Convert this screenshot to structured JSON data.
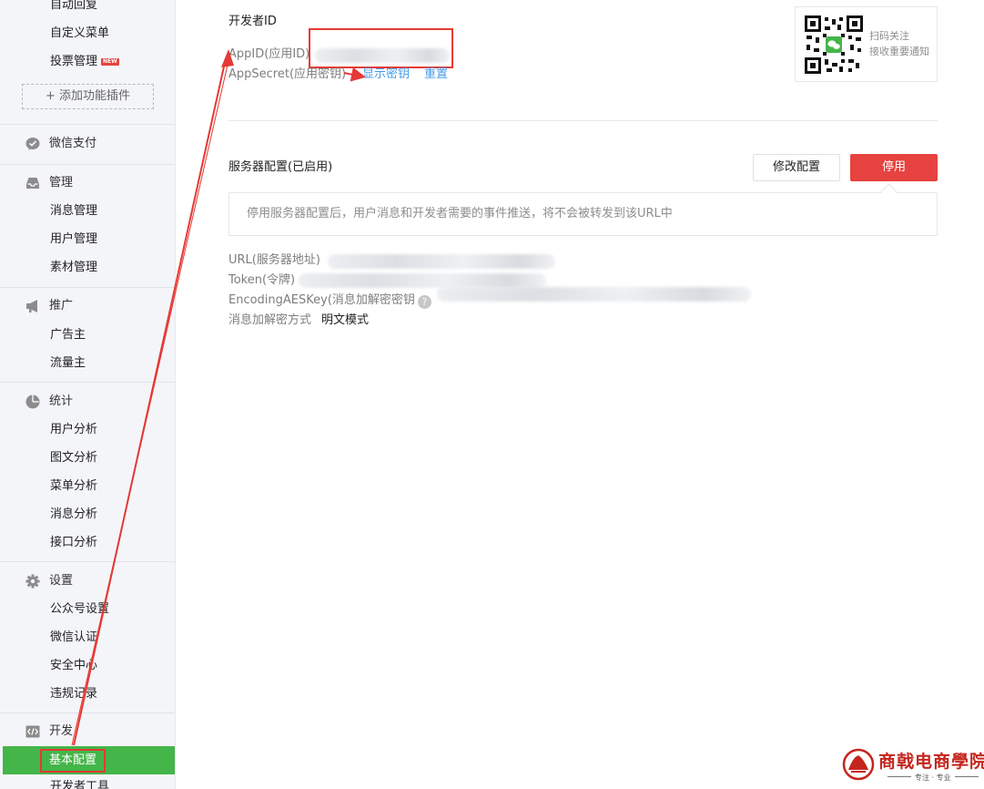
{
  "sidebar": {
    "plugin_items": [
      {
        "label": "自动回复"
      },
      {
        "label": "自定义菜单"
      },
      {
        "label": "投票管理",
        "badge": "NEW"
      }
    ],
    "add_plugin_label": "+ 添加功能插件",
    "wechat_pay": {
      "label": "微信支付",
      "icon": "check-chat-icon"
    },
    "groups": [
      {
        "label": "管理",
        "icon": "inbox-icon",
        "items": [
          "消息管理",
          "用户管理",
          "素材管理"
        ]
      },
      {
        "label": "推广",
        "icon": "megaphone-icon",
        "items": [
          "广告主",
          "流量主"
        ]
      },
      {
        "label": "统计",
        "icon": "pie-chart-icon",
        "items": [
          "用户分析",
          "图文分析",
          "菜单分析",
          "消息分析",
          "接口分析"
        ]
      },
      {
        "label": "设置",
        "icon": "gear-icon",
        "items": [
          "公众号设置",
          "微信认证",
          "安全中心",
          "违规记录"
        ]
      },
      {
        "label": "开发",
        "icon": "code-icon",
        "items": [
          "基本配置",
          "开发者工具"
        ]
      }
    ],
    "active_item": "基本配置",
    "active_color": "#44b549"
  },
  "developer": {
    "section_title": "开发者ID",
    "appid_label": "AppID(应用ID)",
    "appsecret_label": "AppSecret(应用密钥)",
    "show_secret_link": "显示密钥",
    "reset_link": "重置"
  },
  "qr": {
    "line1": "扫码关注",
    "line2": "接收重要通知"
  },
  "server": {
    "title": "服务器配置(已启用)",
    "modify_button": "修改配置",
    "disable_button": "停用",
    "notice": "停用服务器配置后，用户消息和开发者需要的事件推送，将不会被转发到该URL中",
    "url_label": "URL(服务器地址)",
    "token_label": "Token(令牌)",
    "aes_label": "EncodingAESKey(消息加解密密钥",
    "aes_help": "?",
    "aes_close": ")",
    "mode_label": "消息加解密方式",
    "mode_value": "明文模式"
  },
  "brand": {
    "name": "商戟电商學院",
    "slogan": "专注 · 专业"
  },
  "colors": {
    "danger": "#e64340",
    "link": "#459ae9",
    "annotation": "#e53935"
  }
}
